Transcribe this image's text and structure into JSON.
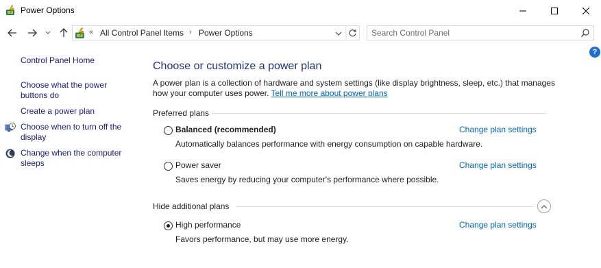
{
  "window": {
    "title": "Power Options",
    "minimize_icon": "minimize-icon",
    "maximize_icon": "maximize-icon",
    "close_icon": "close-icon"
  },
  "nav": {
    "breadcrumb_overflow": "«",
    "breadcrumbs": [
      "All Control Panel Items",
      "Power Options"
    ],
    "breadcrumb_separator": "›",
    "search_placeholder": "Search Control Panel"
  },
  "help": {
    "label": "?"
  },
  "sidebar": {
    "home": "Control Panel Home",
    "items": [
      "Choose what the power buttons do",
      "Create a power plan",
      "Choose when to turn off the display",
      "Change when the computer sleeps"
    ]
  },
  "main": {
    "title": "Choose or customize a power plan",
    "description": "A power plan is a collection of hardware and system settings (like display brightness, sleep, etc.) that manages how your computer uses power.",
    "description_link": "Tell me more about power plans",
    "preferred_header": "Preferred plans",
    "additional_header": "Hide additional plans",
    "change_link": "Change plan settings",
    "plans": [
      {
        "name": "Balanced (recommended)",
        "description": "Automatically balances performance with energy consumption on capable hardware.",
        "selected": false
      },
      {
        "name": "Power saver",
        "description": "Saves energy by reducing your computer's performance where possible.",
        "selected": false
      },
      {
        "name": "High performance",
        "description": "Favors performance, but may use more energy.",
        "selected": true
      }
    ]
  },
  "colors": {
    "title_blue": "#1e3287",
    "link_blue": "#0066cc",
    "help_blue": "#1e6ed2"
  }
}
